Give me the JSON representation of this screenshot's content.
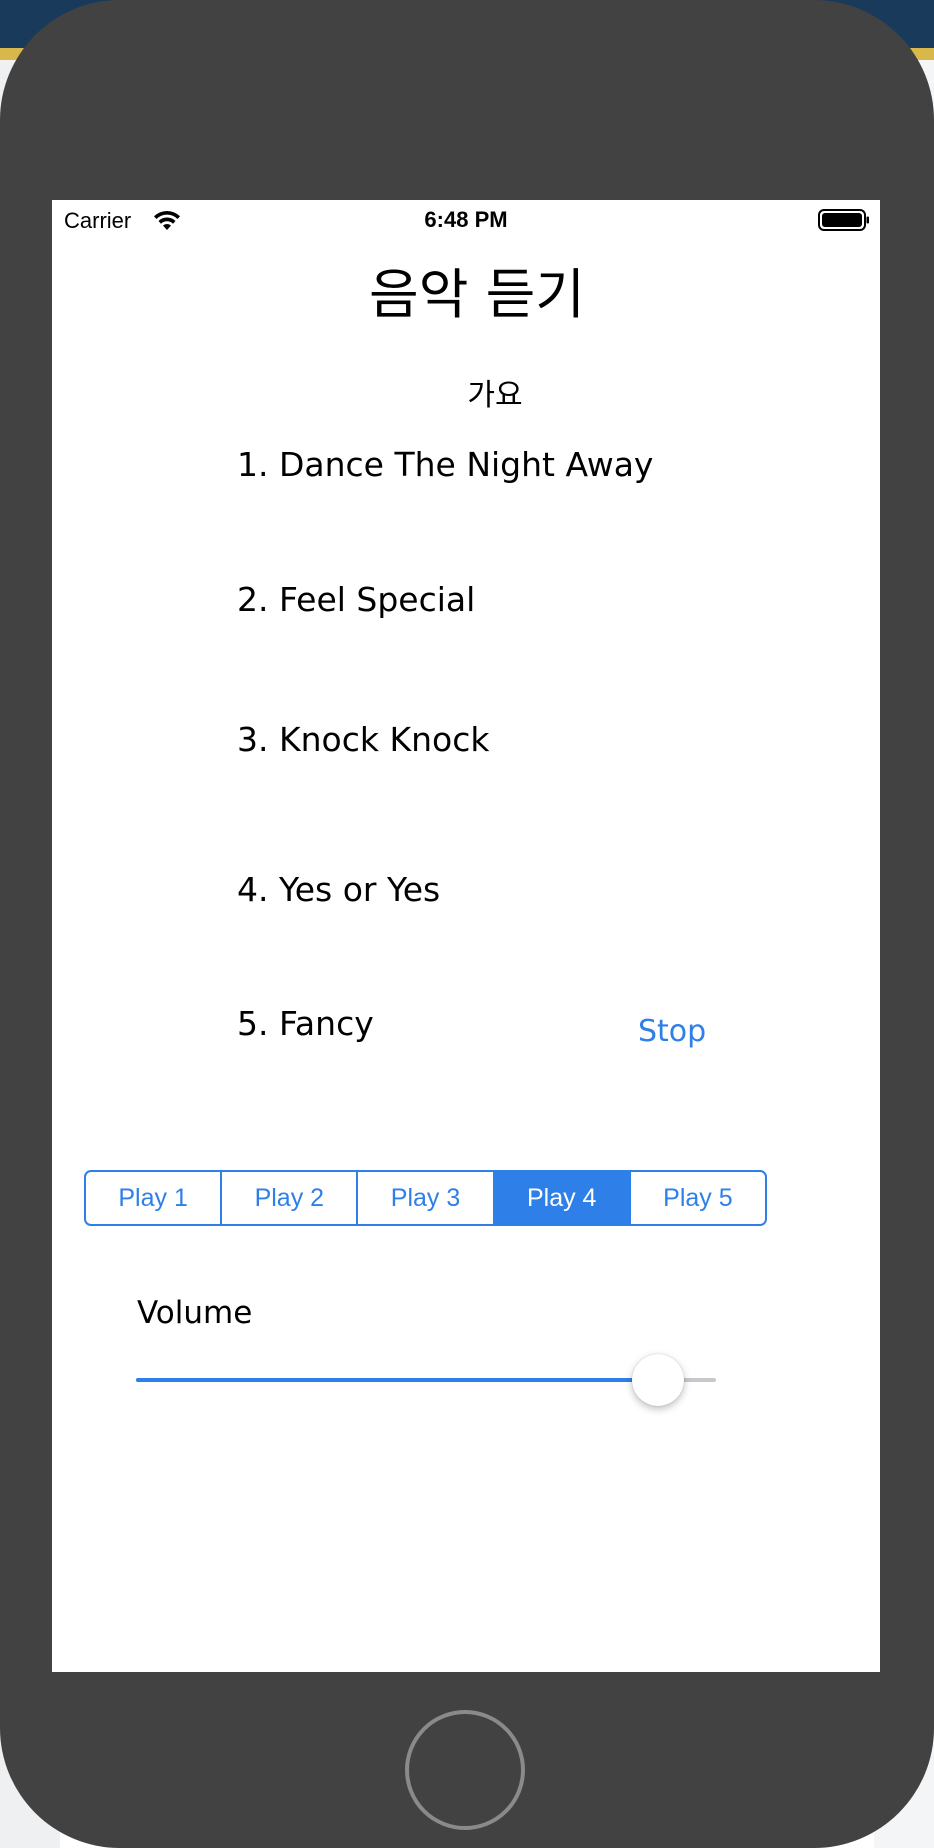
{
  "status_bar": {
    "carrier": "Carrier",
    "time": "6:48 PM",
    "wifi_icon": "wifi-icon",
    "battery_icon": "battery-full-icon"
  },
  "title": "음악 듣기",
  "genre": "가요",
  "songs": [
    "1. Dance The Night Away",
    "2. Feel Special",
    "3. Knock Knock",
    "4. Yes or Yes",
    "5. Fancy"
  ],
  "stop_label": "Stop",
  "segments": [
    {
      "label": "Play 1",
      "selected": false
    },
    {
      "label": "Play 2",
      "selected": false
    },
    {
      "label": "Play 3",
      "selected": false
    },
    {
      "label": "Play 4",
      "selected": true
    },
    {
      "label": "Play 5",
      "selected": false
    }
  ],
  "volume": {
    "label": "Volume",
    "value": 0.94
  },
  "colors": {
    "accent": "#2f7fe8",
    "device": "#424242"
  }
}
